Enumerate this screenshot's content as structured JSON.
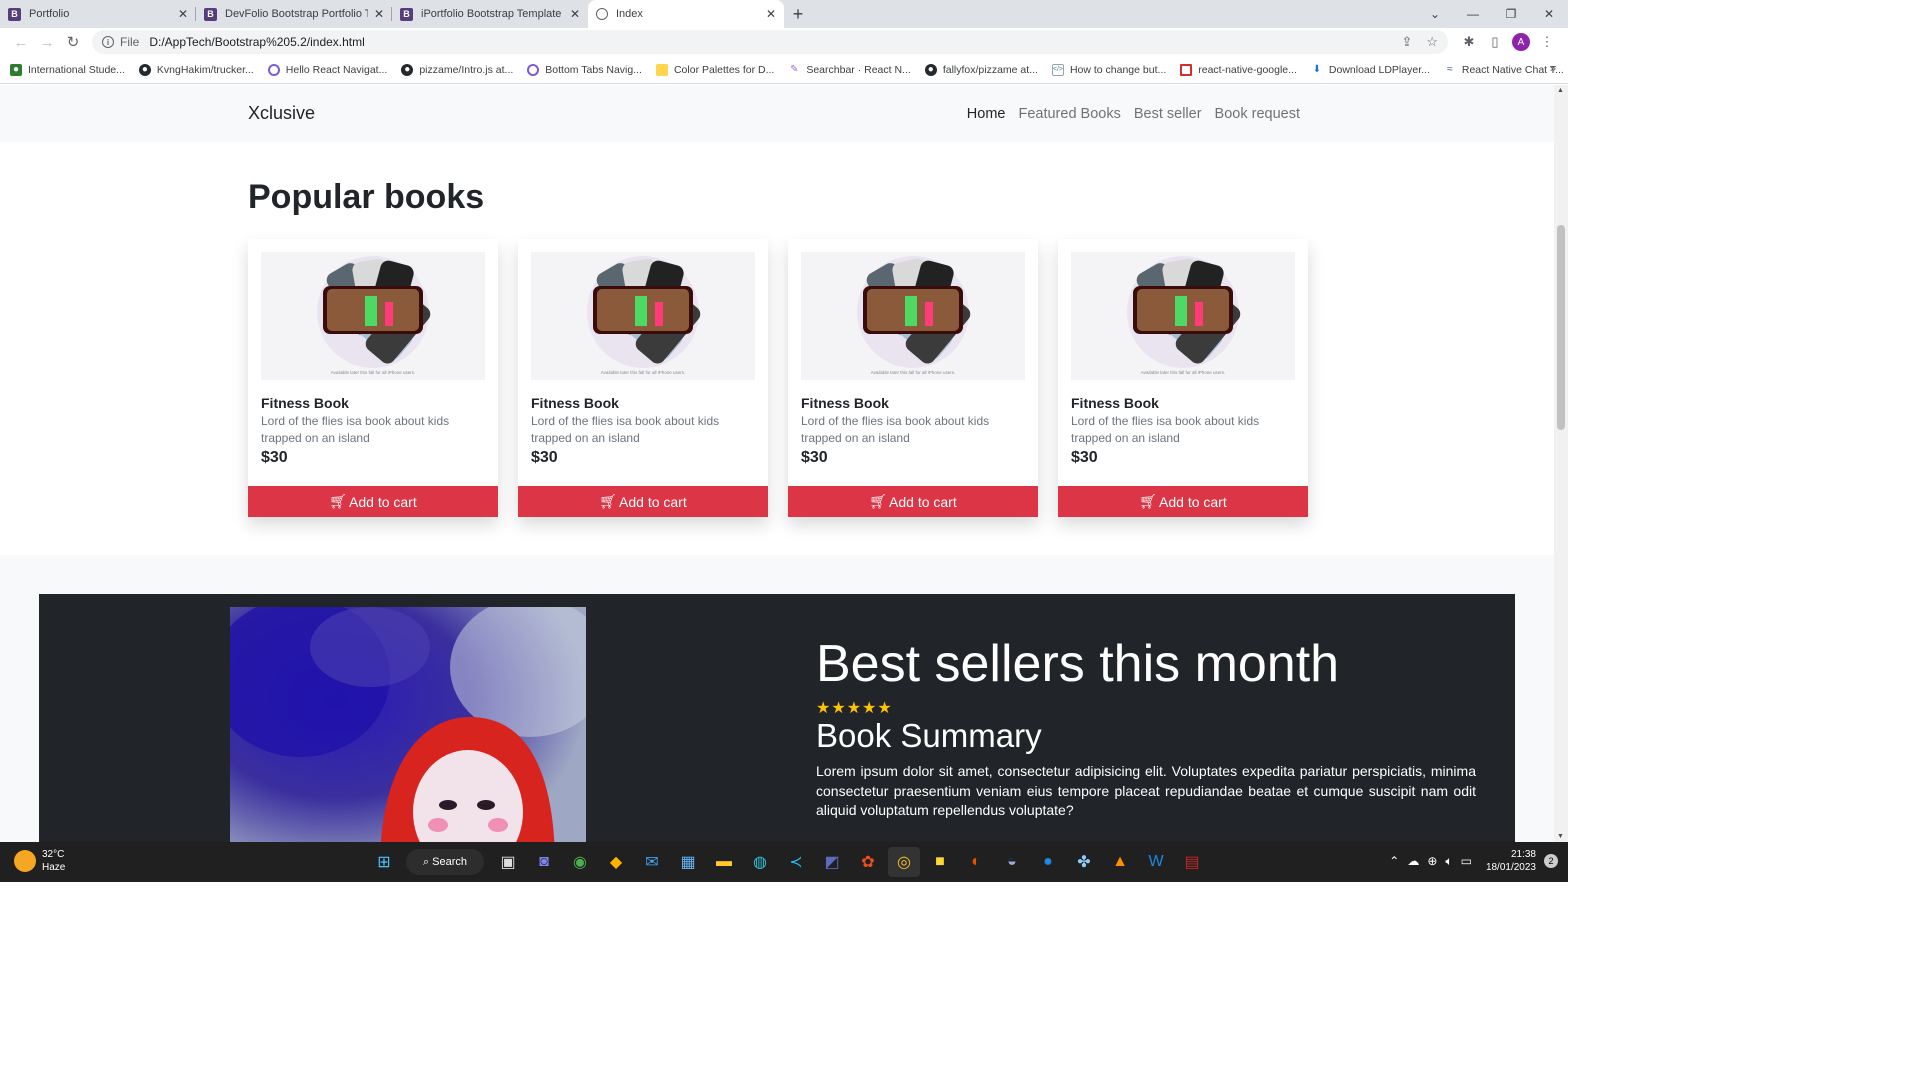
{
  "browser": {
    "tabs": [
      {
        "title": "Portfolio",
        "icon": "bootstrap-icon"
      },
      {
        "title": "DevFolio Bootstrap Portfolio Tem",
        "icon": "bootstrap-icon"
      },
      {
        "title": "iPortfolio Bootstrap Template - Ir",
        "icon": "bootstrap-icon"
      },
      {
        "title": "Index",
        "icon": "globe-icon"
      }
    ],
    "scheme": "File",
    "url": "D:/AppTech/Bootstrap%205.2/index.html",
    "avatar_letter": "A",
    "bookmarks": [
      "International Stude...",
      "KvngHakim/trucker...",
      "Hello React Navigat...",
      "pizzame/Intro.js at...",
      "Bottom Tabs Navig...",
      "Color Palettes for D...",
      "Searchbar · React N...",
      "fallyfox/pizzame at...",
      "How to change but...",
      "react-native-google...",
      "Download LDPlayer...",
      "React Native Chat T..."
    ]
  },
  "navbar": {
    "brand": "Xclusive",
    "links": [
      "Home",
      "Featured Books",
      "Best seller",
      "Book request"
    ]
  },
  "popular": {
    "heading": "Popular books",
    "cards": [
      {
        "title": "Fitness Book",
        "text": "Lord of the flies isa book about kids trapped on an island",
        "price": "$30",
        "button": "Add to cart",
        "caption": "Available later this fall for all iPhone users."
      },
      {
        "title": "Fitness Book",
        "text": "Lord of the flies isa book about kids trapped on an island",
        "price": "$30",
        "button": "Add to cart",
        "caption": "Available later this fall for all iPhone users."
      },
      {
        "title": "Fitness Book",
        "text": "Lord of the flies isa book about kids trapped on an island",
        "price": "$30",
        "button": "Add to cart",
        "caption": "Available later this fall for all iPhone users."
      },
      {
        "title": "Fitness Book",
        "text": "Lord of the flies isa book about kids trapped on an island",
        "price": "$30",
        "button": "Add to cart",
        "caption": "Available later this fall for all iPhone users."
      }
    ]
  },
  "bestsellers": {
    "heading": "Best sellers this month",
    "stars": "★★★★★",
    "rating": 5,
    "subheading": "Book Summary",
    "summary": "Lorem ipsum dolor sit amet, consectetur adipisicing elit. Voluptates expedita pariatur perspiciatis, minima consectetur praesentium veniam eius tempore placeat repudiandae beatae et cumque suscipit nam odit aliquid voluptatum repellendus voluptate?"
  },
  "taskbar": {
    "temperature": "32°C",
    "weather": "Haze",
    "search_label": "Search",
    "time": "21:38",
    "date": "18/01/2023",
    "notifications": "2"
  },
  "colors": {
    "accent_button": "#dc3545",
    "dark_section": "#212529",
    "star": "#ffc107"
  }
}
